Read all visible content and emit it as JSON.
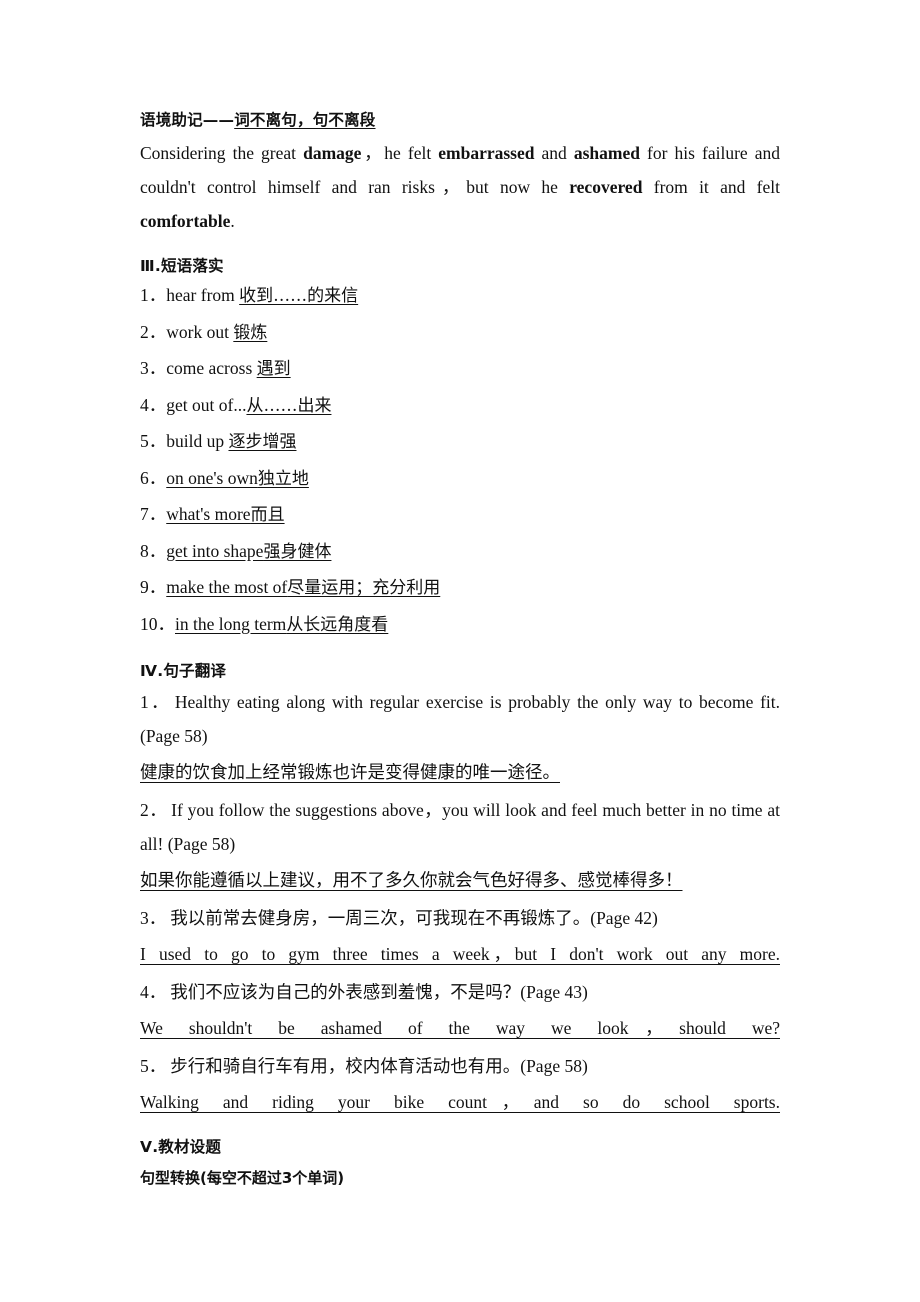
{
  "context": {
    "title_prefix": "语境助记——",
    "title_underlined": "词不离句，句不离段",
    "paragraph_parts": [
      {
        "t": "Considering the great ",
        "b": false
      },
      {
        "t": "damage",
        "b": true
      },
      {
        "t": "，he felt ",
        "b": false
      },
      {
        "t": "embarrassed",
        "b": true
      },
      {
        "t": " and ",
        "b": false
      },
      {
        "t": "ashamed",
        "b": true
      },
      {
        "t": " for his failure and couldn't control himself and ran risks，but now he ",
        "b": false
      },
      {
        "t": "recovered",
        "b": true
      },
      {
        "t": " from it and felt ",
        "b": false
      },
      {
        "t": "comfortable",
        "b": true
      },
      {
        "t": ".",
        "b": false
      }
    ]
  },
  "phrases": {
    "heading": "Ⅲ.短语落实",
    "items": [
      {
        "num": "1．",
        "en": "hear from ",
        "en_underlined": false,
        "answer": "收到……的来信",
        "answer_cn": true
      },
      {
        "num": "2．",
        "en": "work out ",
        "en_underlined": false,
        "answer": "锻炼",
        "answer_cn": true
      },
      {
        "num": "3．",
        "en": "come across ",
        "en_underlined": false,
        "answer": "遇到",
        "answer_cn": true
      },
      {
        "num": "4．",
        "en": "get out of...",
        "en_underlined": false,
        "answer": "从……出来",
        "answer_cn": true
      },
      {
        "num": "5．",
        "en": "build up ",
        "en_underlined": false,
        "answer": "逐步增强",
        "answer_cn": true
      },
      {
        "num": "6．",
        "en": "on one's own",
        "en_underlined": true,
        "answer": "独立地",
        "answer_cn": true
      },
      {
        "num": "7．",
        "en": "what's more",
        "en_underlined": true,
        "answer": "而且",
        "answer_cn": true
      },
      {
        "num": "8．",
        "en": "get into shape",
        "en_underlined": true,
        "answer": "强身健体",
        "answer_cn": true
      },
      {
        "num": "9．",
        "en": "make the most of",
        "en_underlined": true,
        "answer": "尽量运用；充分利用",
        "answer_cn": true
      },
      {
        "num": "10．",
        "en": "in the long term",
        "en_underlined": true,
        "answer": "从长远角度看",
        "answer_cn": true
      }
    ]
  },
  "translation": {
    "heading": "Ⅳ.句子翻译",
    "items": [
      {
        "num": "1．",
        "question": "Healthy eating along with regular exercise is probably the only way to become fit.(Page 58)",
        "answer": "健康的饮食加上经常锻炼也许是变得健康的唯一途径。",
        "answer_lang": "cn"
      },
      {
        "num": "2．",
        "question": "If you follow the suggestions above，you will look and feel much better in no time at all! (Page 58)",
        "answer": "如果你能遵循以上建议，用不了多久你就会气色好得多、感觉棒得多！",
        "answer_lang": "cn"
      },
      {
        "num": "3．",
        "question": "我以前常去健身房，一周三次，可我现在不再锻炼了。(Page 42)",
        "answer": "I used to go to gym three times a week，but I don't work out any more.",
        "answer_lang": "en"
      },
      {
        "num": "4．",
        "question": "我们不应该为自己的外表感到羞愧，不是吗？(Page 43)",
        "answer": "We shouldn't be ashamed of the way we look，should we?",
        "answer_lang": "en"
      },
      {
        "num": "5．",
        "question": "步行和骑自行车有用，校内体育活动也有用。(Page 58)",
        "answer": "Walking and riding your bike count，and so do school sports.",
        "answer_lang": "en"
      }
    ]
  },
  "textbook": {
    "heading": "Ⅴ.教材设题",
    "subheading": "句型转换(每空不超过3个单词)"
  }
}
